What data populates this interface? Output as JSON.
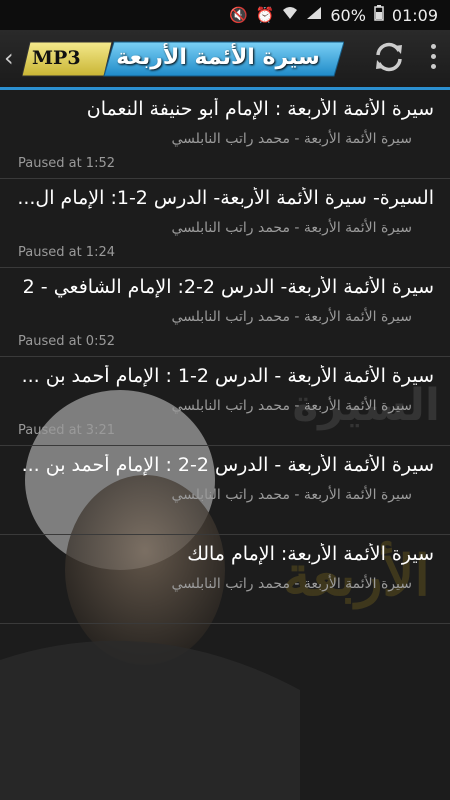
{
  "status_bar": {
    "battery": "60%",
    "time": "01:09"
  },
  "action_bar": {
    "badge": "MP3",
    "title": "سيرة الأئمة الأربعة"
  },
  "items": [
    {
      "title": "سيرة الأئمة الأربعة : الإمام أبو حنيفة النعمان",
      "subtitle": "سيرة الأئمة الأربعة - محمد راتب النابلسي",
      "status": "Paused at 1:52"
    },
    {
      "title": "السيرة- سيرة الأئمة الأربعة- الدرس 2-1: الإمام ال...",
      "subtitle": "سيرة الأئمة الأربعة - محمد راتب النابلسي",
      "status": "Paused at 1:24"
    },
    {
      "title": "سيرة الأئمة الأربعة- الدرس 2-2: الإمام الشافعي - 2",
      "subtitle": "سيرة الأئمة الأربعة - محمد راتب النابلسي",
      "status": "Paused at 0:52"
    },
    {
      "title": "سيرة الأئمة الأربعة - الدرس 2-1 : الإمام أحمد بن ...",
      "subtitle": "سيرة الأئمة الأربعة - محمد راتب النابلسي",
      "status": "Paused at 3:21"
    },
    {
      "title": "سيرة الأئمة الأربعة - الدرس 2-2 : الإمام أحمد بن ...",
      "subtitle": "سيرة الأئمة الأربعة - محمد راتب النابلسي",
      "status": ""
    },
    {
      "title": "سيرة الأئمة الأربعة: الإمام مالك",
      "subtitle": "سيرة الأئمة الأربعة - محمد راتب النابلسي",
      "status": ""
    }
  ],
  "background": {
    "watermark_text": "السيرة الأئمة الأربعة"
  }
}
